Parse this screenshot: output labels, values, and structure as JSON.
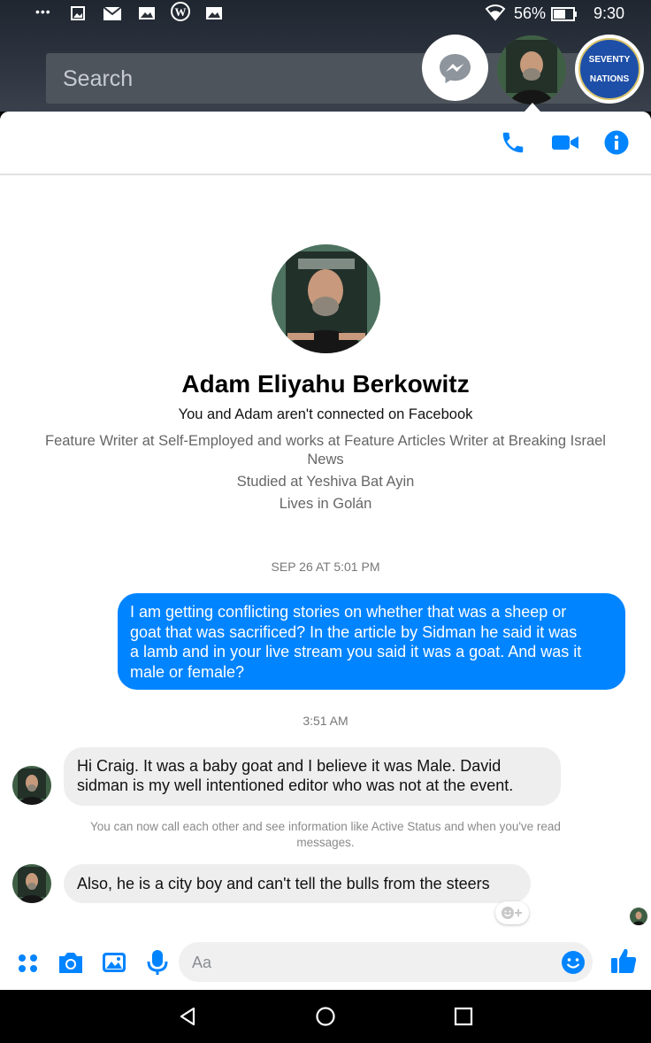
{
  "status_bar": {
    "battery_percent": "56%",
    "time": "9:30",
    "overflow": "•••",
    "icons": [
      "image-icon",
      "mail-icon",
      "photo-icon",
      "wordpress-icon",
      "photo-icon"
    ]
  },
  "search": {
    "placeholder": "Search"
  },
  "chat_heads": {
    "badge_line1": "SEVENTY",
    "badge_line2": "NATIONS"
  },
  "header_actions": [
    "phone-icon",
    "video-icon",
    "info-icon"
  ],
  "profile": {
    "name": "Adam Eliyahu Berkowitz",
    "connection": "You and Adam aren't connected on Facebook",
    "work_line1": "Feature Writer at Self-Employed and works at Feature Articles Writer at Breaking Israel",
    "work_line2": "News",
    "education": "Studied at Yeshiva Bat Ayin",
    "location": "Lives in Golán"
  },
  "conversation": {
    "timestamp1": "SEP 26 AT 5:01 PM",
    "outgoing": {
      "lines": [
        "I am getting conflicting stories on whether that was a sheep or",
        "goat that was sacrificed? In the article by Sidman he said it was",
        "a lamb and in your live stream you said it was a goat. And was it",
        "male or female?"
      ]
    },
    "timestamp2": "3:51 AM",
    "incoming1": {
      "lines": [
        "Hi Craig.  It was a baby goat and I believe it was Male. David",
        "sidman is my well intentioned editor who was not at the event."
      ]
    },
    "system_note_line1": "You can now call each other and see information like Active Status and when you've read",
    "system_note_line2": "messages.",
    "incoming2": "Also, he is a city boy and can't tell the bulls from the steers"
  },
  "composer": {
    "placeholder": "Aa",
    "icons": [
      "apps-icon",
      "camera-icon",
      "gallery-icon",
      "microphone-icon",
      "emoji-icon",
      "like-icon"
    ]
  },
  "colors": {
    "accent": "#0084ff",
    "bubble_in": "#eeeeef",
    "muted_text": "#666666"
  }
}
